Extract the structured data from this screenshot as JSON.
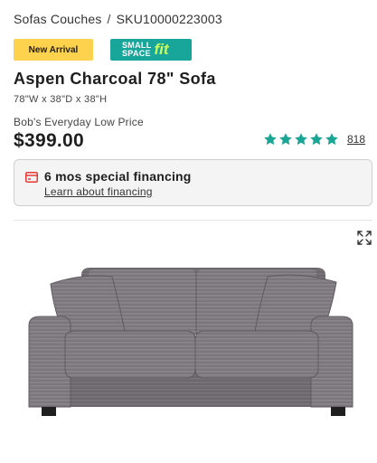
{
  "breadcrumb": {
    "category": "Sofas Couches",
    "separator": "/",
    "sku": "SKU10000223003"
  },
  "badges": {
    "new_arrival": "New Arrival",
    "small_space_line1": "SMALL",
    "small_space_line2": "SPACE",
    "small_space_fit": "fit"
  },
  "product": {
    "title": "Aspen Charcoal 78\" Sofa",
    "dimensions": "78\"W x 38\"D x 38\"H"
  },
  "pricing": {
    "label": "Bob's Everyday Low Price",
    "price": "$399.00"
  },
  "rating": {
    "stars": 5,
    "review_count": "818",
    "star_color": "#1aa595"
  },
  "financing": {
    "title": "6 mos special financing",
    "link": "Learn about financing",
    "icon": "credit-card-icon"
  },
  "image": {
    "icons": [
      "expand-icon"
    ],
    "sofa_color": "#7b767b"
  },
  "colors": {
    "new_arrival_bg": "#ffd24d",
    "small_space_bg": "#19a69a",
    "fit_accent": "#c9ff60",
    "financing_icon": "#e53935"
  }
}
